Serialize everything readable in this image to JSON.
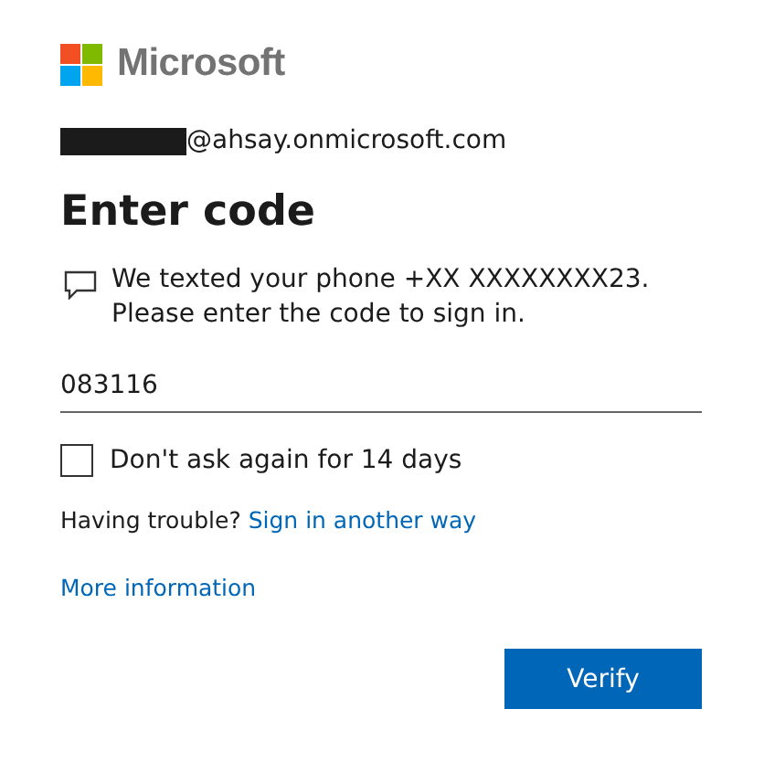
{
  "brand": {
    "name": "Microsoft"
  },
  "account": {
    "email": "@ahsay.onmicrosoft.com"
  },
  "title": "Enter code",
  "message": "We texted your phone +XX XXXXXXXX23. Please enter the code to sign in.",
  "code_field": {
    "value": "083116"
  },
  "remember": {
    "label": "Don't ask again for 14 days",
    "checked": false
  },
  "trouble": {
    "text": "Having trouble?",
    "link": "Sign in another way"
  },
  "more_info": "More information",
  "buttons": [
    {
      "label": "Verify"
    }
  ]
}
